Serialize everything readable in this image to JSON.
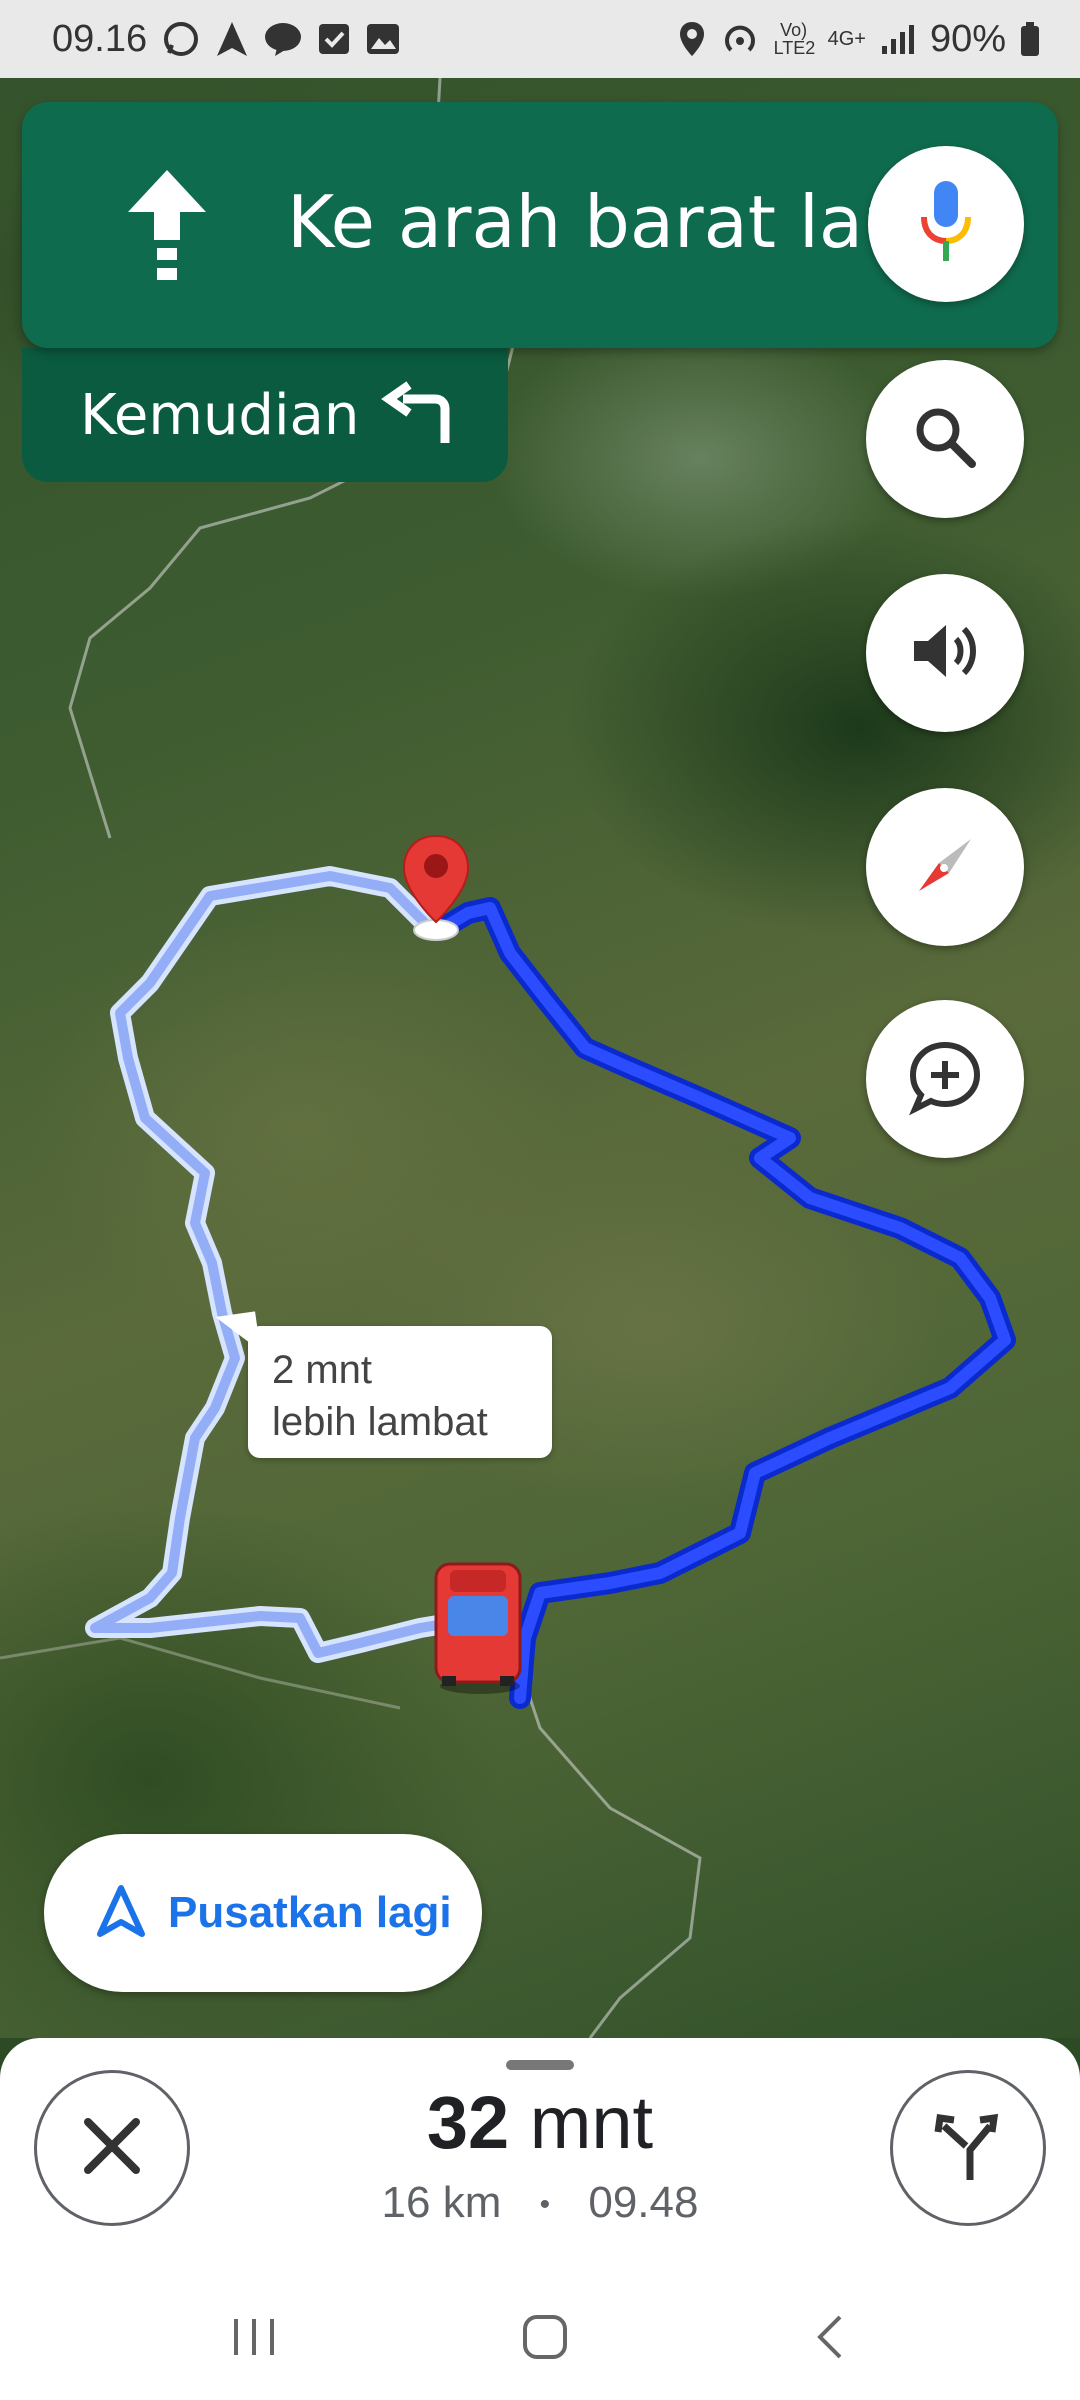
{
  "status_bar": {
    "time": "09.16",
    "network": "Vo) LTE2",
    "signal": "4G+",
    "battery": "90%"
  },
  "navigation": {
    "instruction": "Ke arah barat laut",
    "then_label": "Kemudian",
    "direction_icon": "arrow-up-icon",
    "next_turn_icon": "turn-left-icon"
  },
  "map": {
    "route_callout_line1": "2 mnt",
    "route_callout_line2": "lebih lambat",
    "active_route_color": "#1a3dff",
    "alt_route_color": "#a9c2ff"
  },
  "recenter_label": "Pusatkan lagi",
  "trip": {
    "duration_value": "32",
    "duration_unit": " mnt",
    "distance": "16 km",
    "separator": "•",
    "arrival": "09.48"
  },
  "accent": "#0f6b4e"
}
